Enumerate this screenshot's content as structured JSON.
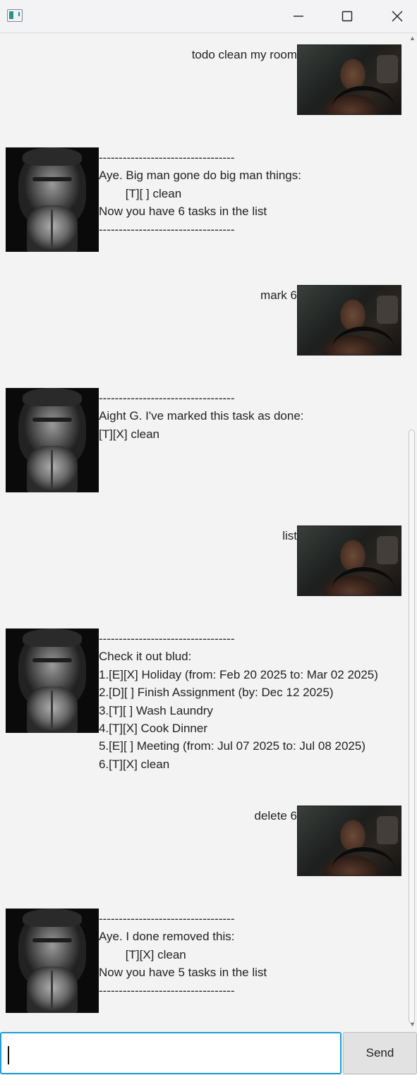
{
  "window": {
    "title": "",
    "controls": {
      "minimize_icon": "minimize-icon",
      "maximize_icon": "maximize-icon",
      "close_icon": "close-icon"
    }
  },
  "conversation": [
    {
      "speaker": "user",
      "text": "todo clean my room"
    },
    {
      "speaker": "bot",
      "lines": [
        "----------------------------------",
        "Aye. Big man gone do big man things:",
        "        [T][ ] clean",
        "Now you have 6 tasks in the list",
        "----------------------------------"
      ]
    },
    {
      "speaker": "user",
      "text": "mark 6"
    },
    {
      "speaker": "bot",
      "lines": [
        "----------------------------------",
        "Aight G. I've marked this task as done:",
        "[T][X] clean"
      ]
    },
    {
      "speaker": "user",
      "text": "list"
    },
    {
      "speaker": "bot",
      "lines": [
        "----------------------------------",
        "Check it out blud:",
        "1.[E][X] Holiday (from: Feb 20 2025 to: Mar 02 2025)",
        "2.[D][ ] Finish Assignment (by: Dec 12 2025)",
        "3.[T][ ] Wash Laundry",
        "4.[T][X] Cook Dinner",
        "5.[E][ ] Meeting (from: Jul 07 2025 to: Jul 08 2025)",
        "6.[T][X] clean"
      ]
    },
    {
      "speaker": "user",
      "text": "delete 6"
    },
    {
      "speaker": "bot",
      "lines": [
        "----------------------------------",
        "Aye. I done removed this:",
        "        [T][X] clean",
        "Now you have 5 tasks in the list",
        "----------------------------------"
      ]
    }
  ],
  "input": {
    "value": "",
    "placeholder": ""
  },
  "send_button": {
    "label": "Send"
  },
  "colors": {
    "input_focus_border": "#1f9fd3",
    "background": "#f3f3f3"
  }
}
